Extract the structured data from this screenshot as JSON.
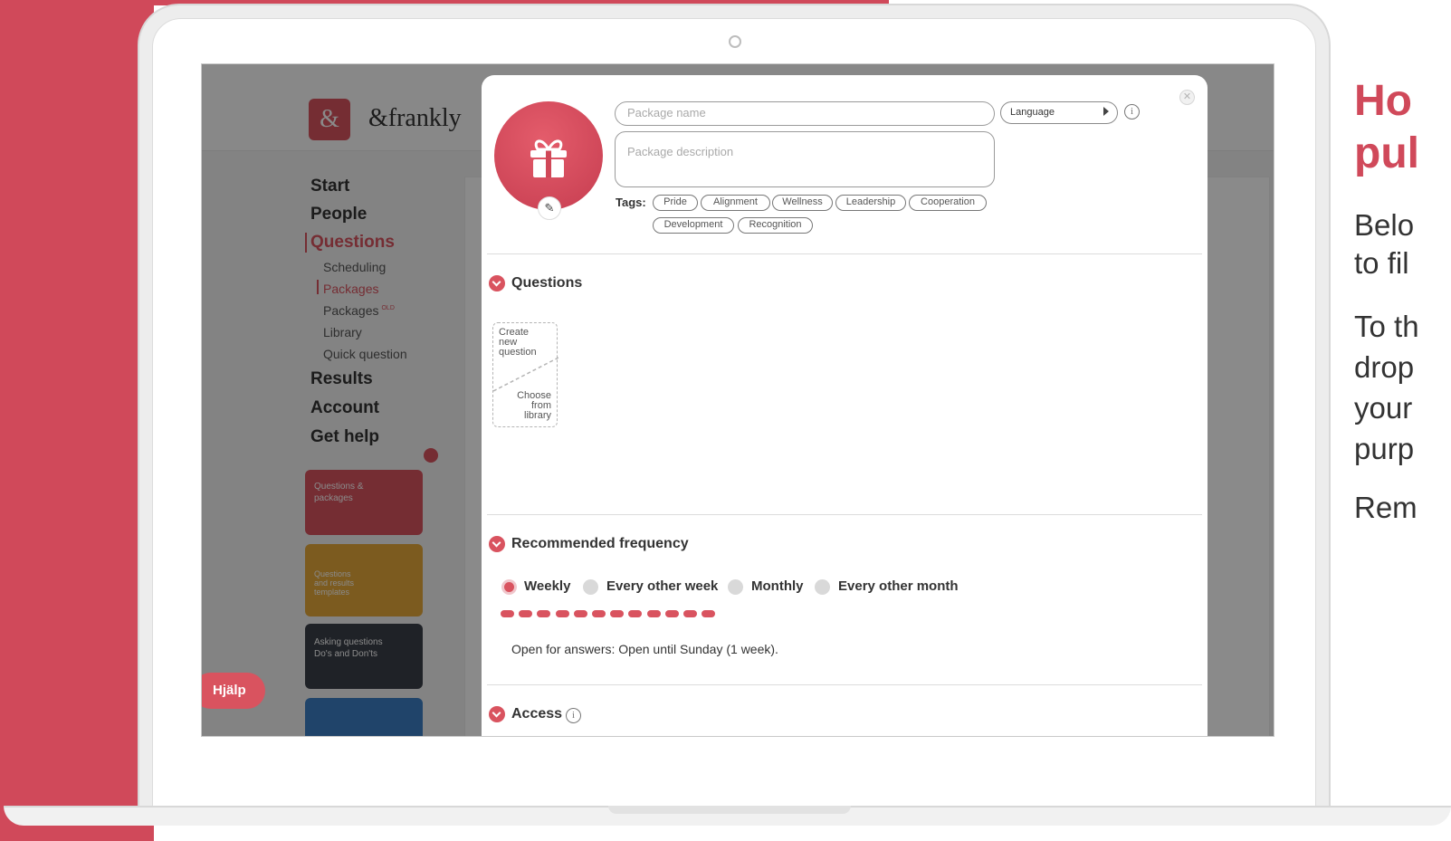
{
  "colors": {
    "brand": "#d0495a",
    "accent": "#d9535f",
    "text": "#333333",
    "muted": "#a9a9a9"
  },
  "app": {
    "logo_symbol": "&",
    "logo_text": "&frankly",
    "help_label": "Hjälp",
    "nav": {
      "start": "Start",
      "people": "People",
      "questions": "Questions",
      "scheduling": "Scheduling",
      "packages": "Packages",
      "packages_old": "Packages",
      "old_badge": "OLD",
      "library": "Library",
      "quick_question": "Quick question",
      "results": "Results",
      "account": "Account",
      "get_help": "Get help"
    },
    "side_cards": {
      "card1": "Questions & packages",
      "card2": "Questions and results templates",
      "card3": "Asking questions Do's and Don'ts"
    }
  },
  "modal": {
    "package_name_placeholder": "Package name",
    "package_description_placeholder": "Package description",
    "language_label": "Language",
    "tags_label": "Tags:",
    "tags": [
      "Pride",
      "Alignment",
      "Wellness",
      "Leadership",
      "Cooperation",
      "Development",
      "Recognition"
    ],
    "sections": {
      "questions": "Questions",
      "frequency": "Recommended frequency",
      "access": "Access"
    },
    "question_card": {
      "create_label": "Create new question",
      "library_label": "Choose from library"
    },
    "frequency_options": [
      "Weekly",
      "Every other week",
      "Monthly",
      "Every other month"
    ],
    "selected_frequency": "Weekly",
    "frequency_dash_count": 12,
    "open_for_answers": "Open for answers: Open until Sunday (1 week)."
  },
  "side_text": {
    "title_line1": "Ho",
    "title_line2": "pul",
    "p1_line1": "Belo",
    "p1_line2": "to fil",
    "p2_line1": "To th",
    "p2_line2": "drop",
    "p2_line3": "your",
    "p2_line4": "purp",
    "p3_line1": "Rem"
  }
}
